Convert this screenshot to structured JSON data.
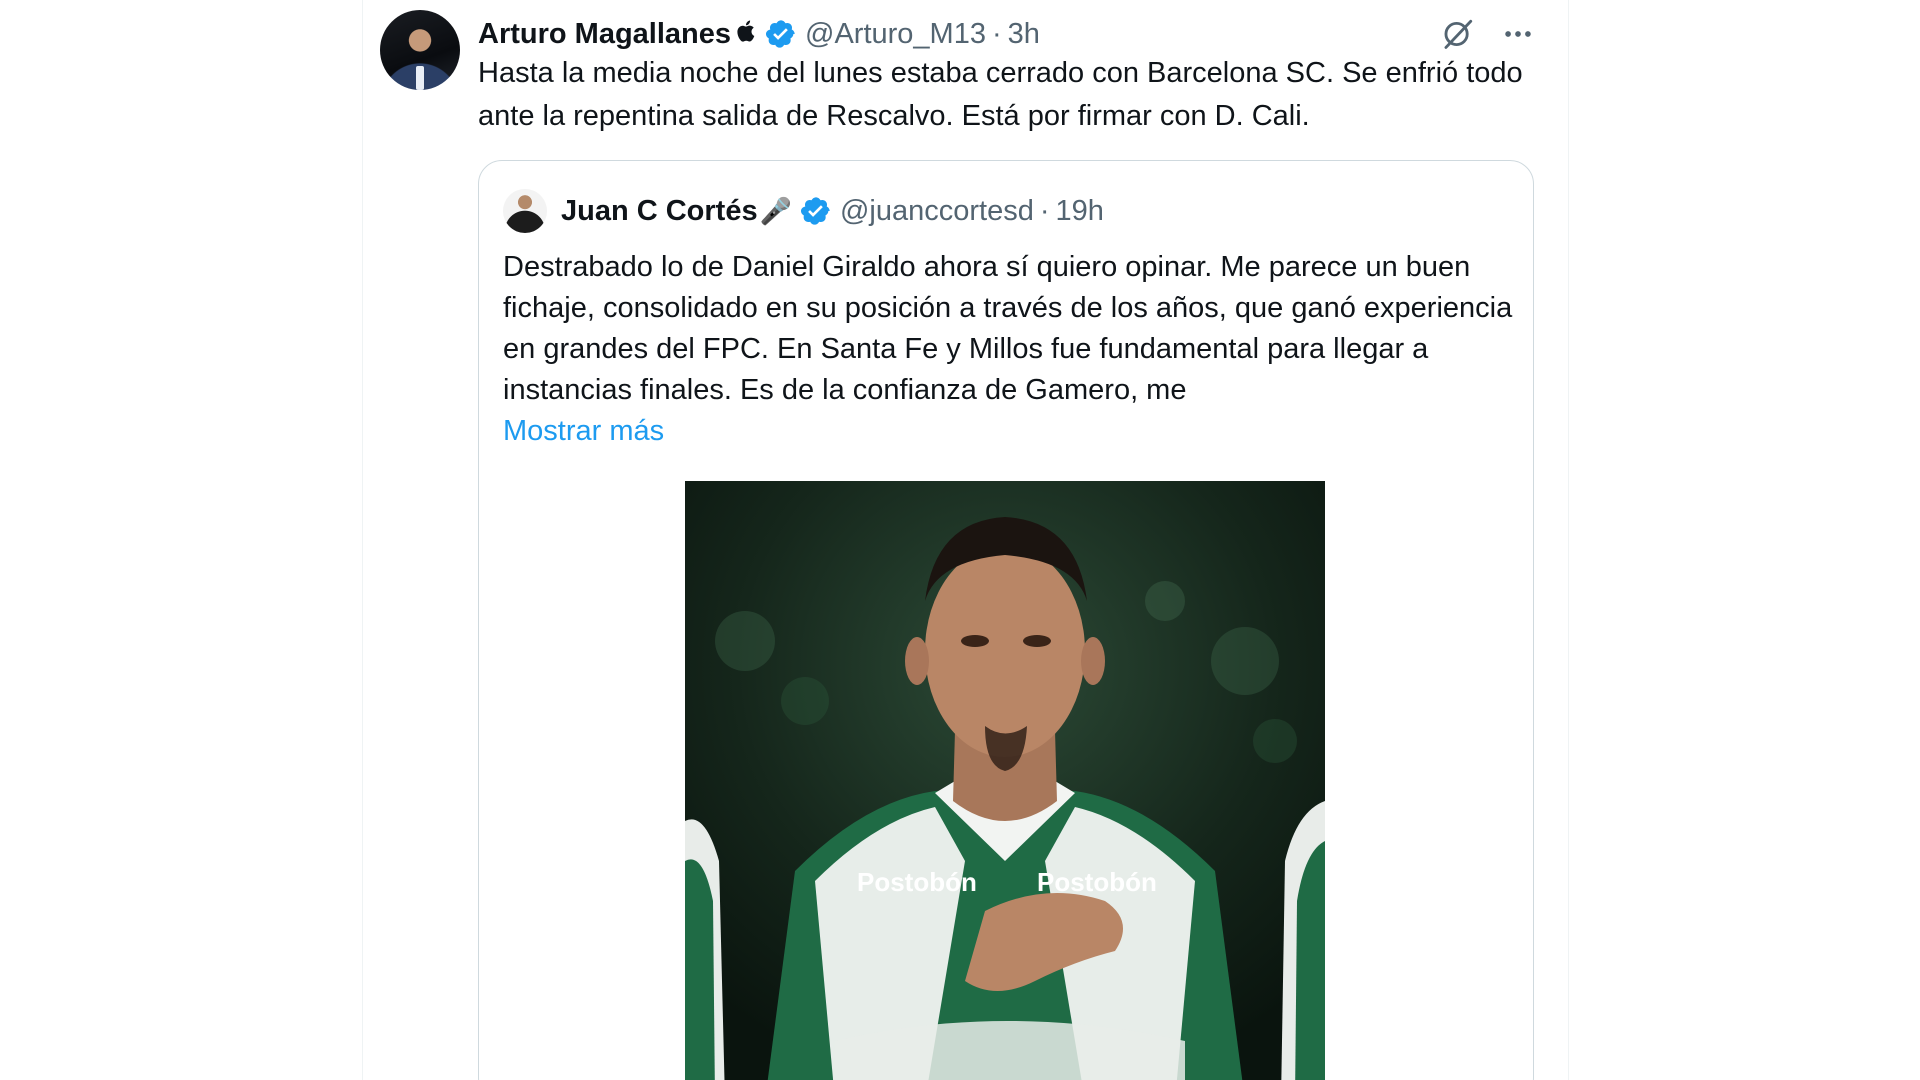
{
  "tweet": {
    "author_name": "Arturo Magallanes",
    "author_affil_icon": "apple-icon",
    "handle": "@Arturo_M13",
    "separator": "·",
    "time": "3h",
    "text": "Hasta la media noche del lunes estaba cerrado con Barcelona SC. Se enfrió todo ante la repentina salida de Rescalvo. Está por firmar con D. Cali."
  },
  "quote": {
    "author_name": "Juan C Cortés",
    "author_emoji": "🎤",
    "handle": "@juanccortesd",
    "separator": "·",
    "time": "19h",
    "text": "Destrabado lo de Daniel Giraldo ahora sí quiero opinar. Me parece un buen fichaje, consolidado en su posición a través de los años, que ganó experiencia en grandes del FPC. En Santa Fe y Millos fue fundamental para llegar a instancias finales. Es de la confianza de Gamero, me",
    "show_more": "Mostrar más",
    "image_jersey_text": "Postobón"
  },
  "colors": {
    "text_primary": "#0f1419",
    "text_secondary": "#536471",
    "accent": "#1d9bf0",
    "border": "#cfd9de",
    "jersey_green": "#1f6b45"
  }
}
